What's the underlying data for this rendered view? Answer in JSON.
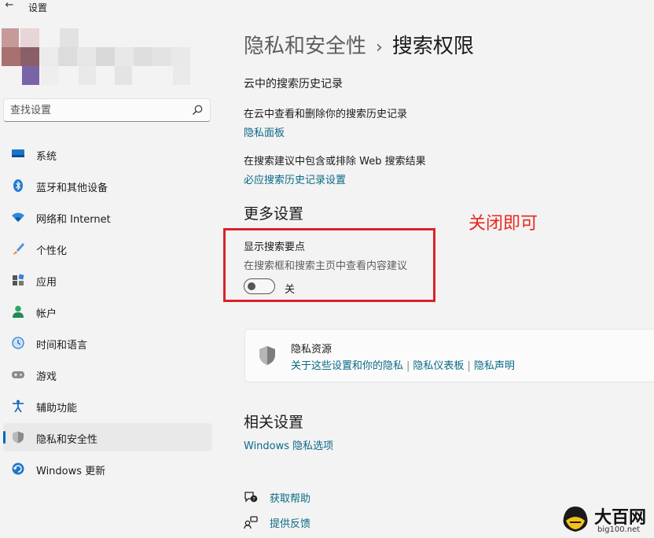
{
  "window": {
    "title": "设置"
  },
  "search": {
    "placeholder": "查找设置"
  },
  "sidebar": {
    "items": [
      {
        "label": "系统",
        "icon": "monitor-icon"
      },
      {
        "label": "蓝牙和其他设备",
        "icon": "bluetooth-icon"
      },
      {
        "label": "网络和 Internet",
        "icon": "wifi-icon"
      },
      {
        "label": "个性化",
        "icon": "brush-icon"
      },
      {
        "label": "应用",
        "icon": "apps-icon"
      },
      {
        "label": "帐户",
        "icon": "person-icon"
      },
      {
        "label": "时间和语言",
        "icon": "globe-clock-icon"
      },
      {
        "label": "游戏",
        "icon": "gamepad-icon"
      },
      {
        "label": "辅助功能",
        "icon": "accessibility-icon"
      },
      {
        "label": "隐私和安全性",
        "icon": "shield-icon",
        "active": true
      },
      {
        "label": "Windows 更新",
        "icon": "update-icon"
      }
    ]
  },
  "breadcrumb": {
    "parent": "隐私和安全性",
    "separator": "›",
    "current": "搜索权限"
  },
  "cloud_history": {
    "title": "云中的搜索历史记录",
    "manage_desc": "在云中查看和删除你的搜索历史记录",
    "dashboard_link": "隐私面板",
    "web_desc": "在搜索建议中包含或排除 Web 搜索结果",
    "bing_link": "必应搜索历史记录设置"
  },
  "more_settings": {
    "title": "更多设置",
    "highlights_title": "显示搜索要点",
    "highlights_desc": "在搜索框和搜索主页中查看内容建议",
    "toggle_state": "关",
    "toggle_on": false
  },
  "annotation": {
    "text": "关闭即可",
    "color": "#e8291f"
  },
  "privacy_resources": {
    "title": "隐私资源",
    "links": [
      "关于这些设置和你的隐私",
      "隐私仪表板",
      "隐私声明"
    ],
    "separator": "|"
  },
  "related": {
    "title": "相关设置",
    "link": "Windows 隐私选项"
  },
  "help": {
    "get_help": "获取帮助",
    "feedback": "提供反馈"
  },
  "watermark": {
    "name": "大百网",
    "url": "big100.net"
  },
  "colors": {
    "accent": "#0067c0",
    "link": "#0a6a86",
    "highlight_red": "#d8222a"
  }
}
